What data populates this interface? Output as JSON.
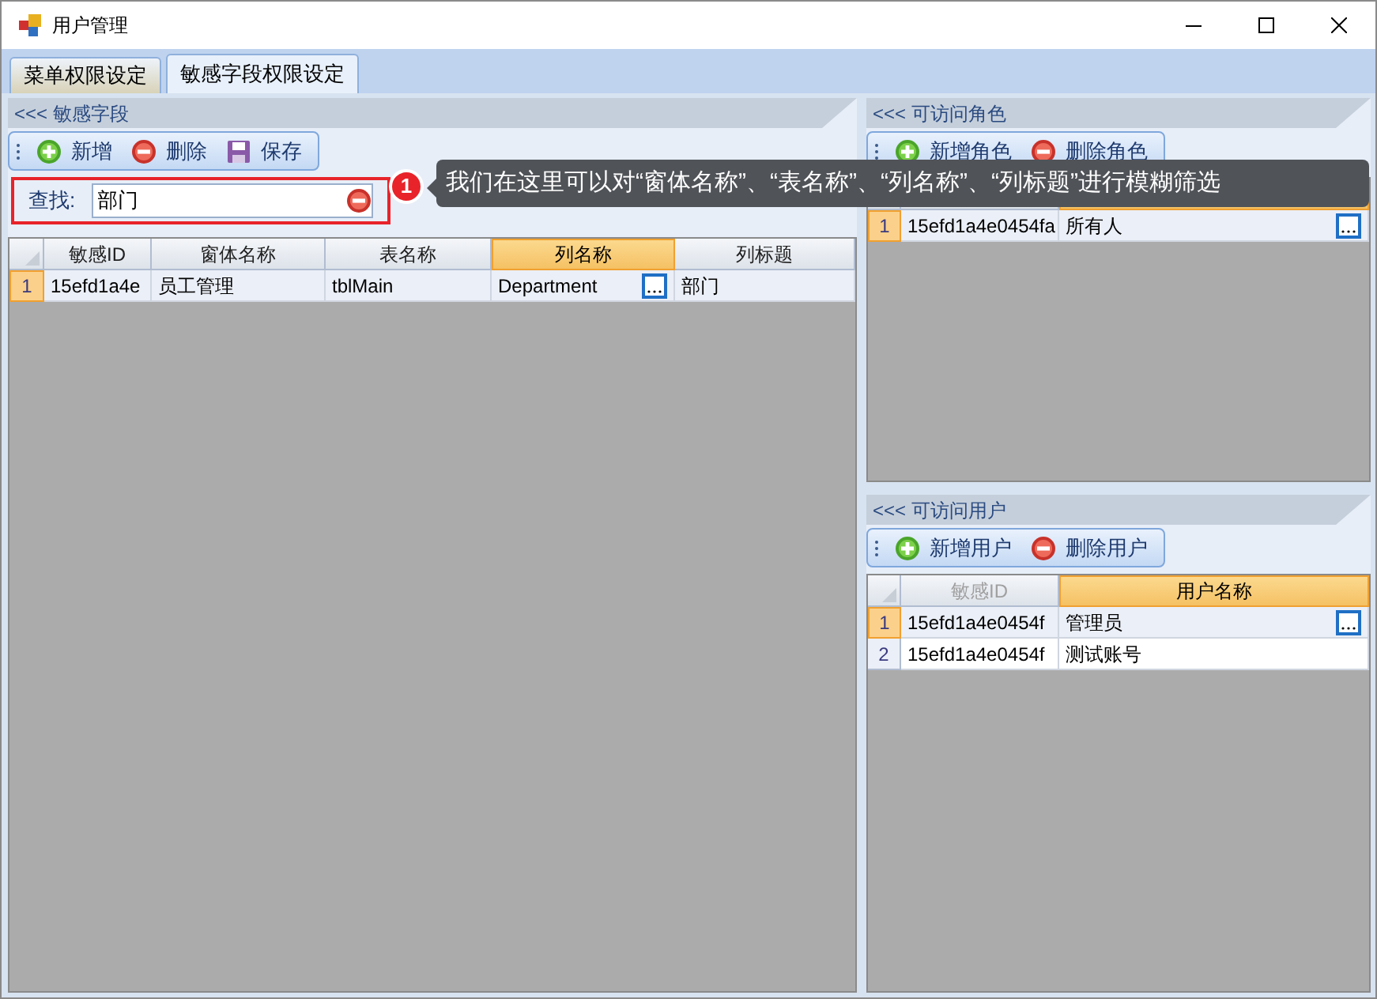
{
  "window": {
    "title": "用户管理"
  },
  "tabs": [
    {
      "label": "菜单权限设定",
      "selected": false
    },
    {
      "label": "敏感字段权限设定",
      "selected": true
    }
  ],
  "fields_panel": {
    "header": "<<< 敏感字段",
    "toolbar": [
      {
        "label": "新增",
        "kind": "add"
      },
      {
        "label": "删除",
        "kind": "delete"
      },
      {
        "label": "保存",
        "kind": "save"
      }
    ],
    "search": {
      "label": "查找:",
      "value": "部门"
    },
    "callout": {
      "number": "1",
      "text": "我们在这里可以对“窗体名称”、“表名称”、“列名称”、“列标题”进行模糊筛选"
    },
    "grid": {
      "columns": [
        {
          "label": "敏感ID",
          "selected": false
        },
        {
          "label": "窗体名称",
          "selected": false
        },
        {
          "label": "表名称",
          "selected": false
        },
        {
          "label": "列名称",
          "selected": true
        },
        {
          "label": "列标题",
          "selected": false
        }
      ],
      "rows": [
        {
          "number": "1",
          "selected": true,
          "cells": [
            "15efd1a4e",
            "员工管理",
            "tblMain",
            "Department",
            "部门"
          ]
        }
      ]
    }
  },
  "roles_panel": {
    "header": "<<< 可访问角色",
    "toolbar": [
      {
        "label": "新增角色",
        "kind": "add"
      },
      {
        "label": "删除角色",
        "kind": "delete"
      }
    ],
    "grid": {
      "columns": [
        {
          "selected": false
        },
        {
          "selected": true
        }
      ],
      "rows": [
        {
          "number": "1",
          "selected": true,
          "cells": [
            "15efd1a4e0454fa",
            "所有人"
          ]
        }
      ]
    }
  },
  "users_panel": {
    "header": "<<< 可访问用户",
    "toolbar": [
      {
        "label": "新增用户",
        "kind": "add"
      },
      {
        "label": "删除用户",
        "kind": "delete"
      }
    ],
    "grid": {
      "columns": [
        {
          "label": "敏感ID",
          "selected": false
        },
        {
          "label": "用户名称",
          "selected": true
        }
      ],
      "rows": [
        {
          "number": "1",
          "selected": true,
          "cells": [
            "15efd1a4e0454f",
            "管理员"
          ]
        },
        {
          "number": "2",
          "selected": false,
          "cells": [
            "15efd1a4e0454f",
            "测试账号"
          ]
        }
      ]
    }
  }
}
